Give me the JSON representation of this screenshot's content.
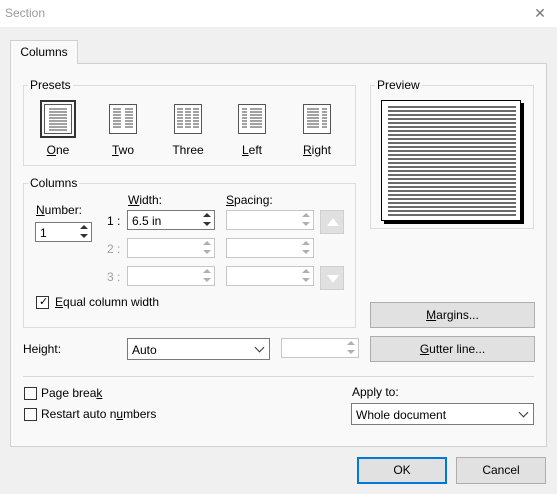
{
  "window": {
    "title": "Section"
  },
  "tabs": [
    {
      "label": "Columns"
    }
  ],
  "presets": {
    "group_label": "Presets",
    "items": [
      {
        "label": "One",
        "underline": "O",
        "rest": "ne",
        "icon": "one-column-icon"
      },
      {
        "label": "Two",
        "underline": "T",
        "rest": "wo",
        "icon": "two-columns-icon"
      },
      {
        "label": "Three",
        "underline": "",
        "rest": "Three",
        "icon": "three-columns-icon"
      },
      {
        "label": "Left",
        "underline": "L",
        "rest": "eft",
        "icon": "left-column-icon"
      },
      {
        "label": "Right",
        "underline": "R",
        "rest": "ight",
        "icon": "right-column-icon"
      }
    ],
    "selected": "One"
  },
  "preview": {
    "label": "Preview"
  },
  "columns": {
    "group_label": "Columns",
    "number_label_u": "N",
    "number_label_rest": "umber:",
    "number_value": "1",
    "width_label_u": "W",
    "width_label_rest": "idth:",
    "spacing_label_u": "S",
    "spacing_label_rest": "pacing:",
    "rows": [
      {
        "index": "1 :",
        "width": "6.5 in",
        "spacing": ""
      },
      {
        "index": "2 :",
        "width": "",
        "spacing": ""
      },
      {
        "index": "3 :",
        "width": "",
        "spacing": ""
      }
    ],
    "equal_width_u": "E",
    "equal_width_rest": "qual column width",
    "equal_width_checked": true
  },
  "buttons": {
    "margins_u": "M",
    "margins_rest": "argins...",
    "gutter_u": "G",
    "gutter_rest": "utter line...",
    "ok": "OK",
    "cancel": "Cancel"
  },
  "height": {
    "label": "Height:",
    "mode": "Auto",
    "value": ""
  },
  "options": {
    "page_break_pre": "Page brea",
    "page_break_u": "k",
    "page_break_post": "",
    "page_break_checked": false,
    "restart_pre": "Restart auto n",
    "restart_u": "u",
    "restart_post": "mbers",
    "restart_checked": false
  },
  "apply_to": {
    "label": "Apply to:",
    "value": "Whole document"
  },
  "colors": {
    "accent": "#0078d7",
    "panel": "#f9f9f9",
    "dialog": "#f0f0f0"
  }
}
